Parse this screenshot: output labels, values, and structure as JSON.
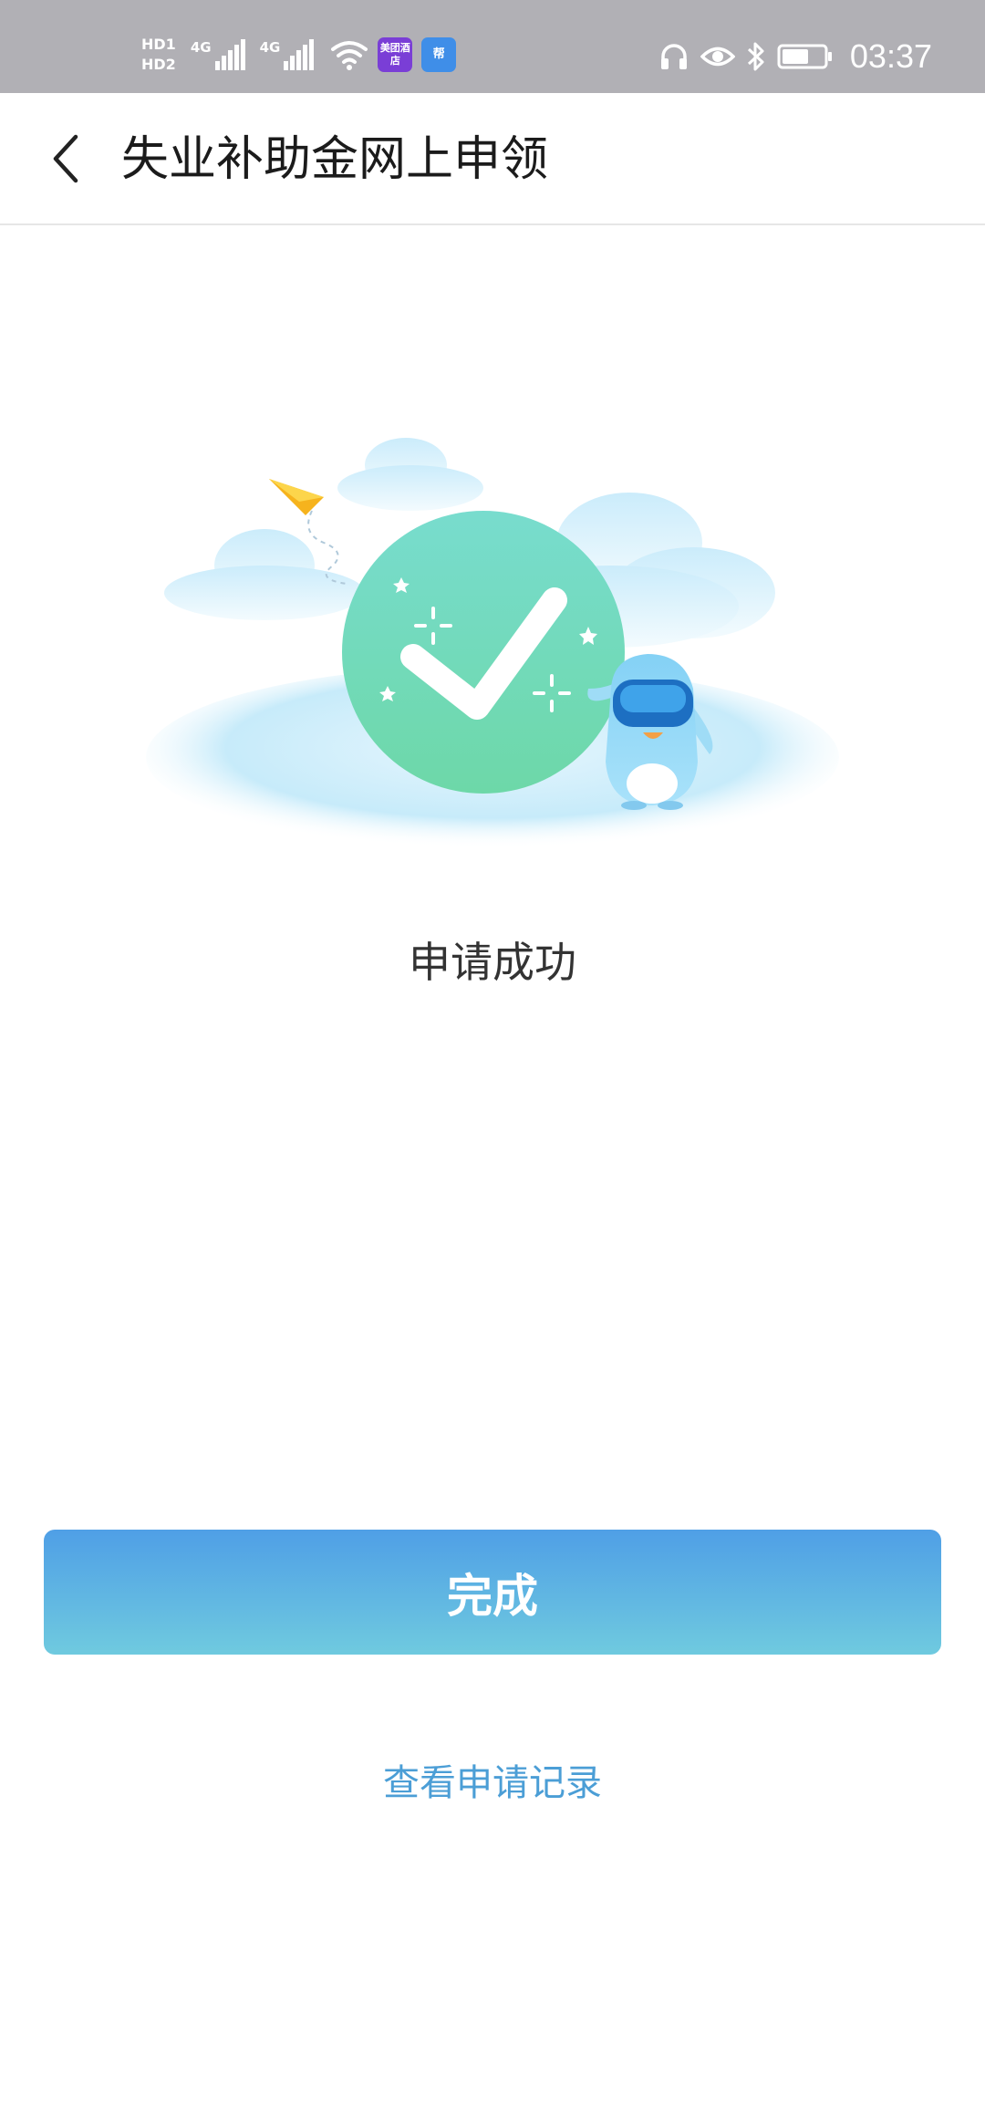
{
  "status_bar": {
    "hd1": "HD1",
    "hd2": "HD2",
    "net1": "4G",
    "net2": "4G",
    "app1": "美团酒店",
    "app2": "帮",
    "time": "03:37",
    "icons": [
      "signal-icon",
      "wifi-icon",
      "headphones-icon",
      "eye-icon",
      "bluetooth-icon",
      "battery-icon"
    ]
  },
  "header": {
    "title": "失业补助金网上申领",
    "back_icon": "chevron-left-icon"
  },
  "result": {
    "message": "申请成功",
    "illustration": "success-checkmark-illustration"
  },
  "actions": {
    "done_label": "完成",
    "records_label": "查看申请记录"
  },
  "colors": {
    "status_bar_bg": "#b1b0b5",
    "button_gradient_top": "#4f9fe6",
    "button_gradient_bottom": "#6fcadf",
    "link": "#4b9ed6",
    "check_circle": "#72dbc6"
  }
}
